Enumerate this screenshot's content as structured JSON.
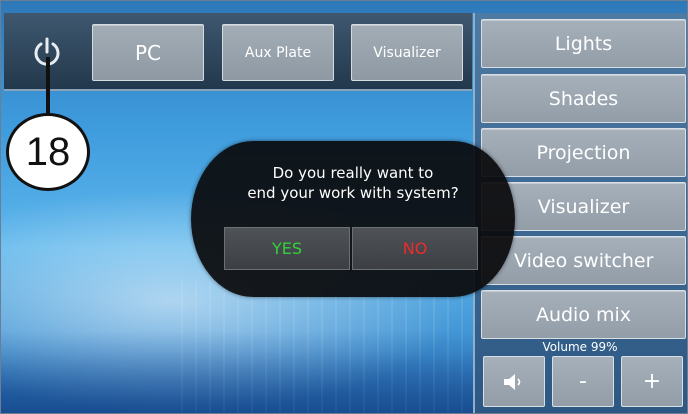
{
  "top_bar": {
    "power_icon": "power-icon",
    "buttons": [
      {
        "label": "PC"
      },
      {
        "label": "Aux Plate"
      },
      {
        "label": "Visualizer"
      }
    ]
  },
  "callout": {
    "number": "18"
  },
  "side_menu": {
    "items": [
      {
        "label": "Lights"
      },
      {
        "label": "Shades"
      },
      {
        "label": "Projection"
      },
      {
        "label": "Visualizer"
      },
      {
        "label": "Video switcher"
      },
      {
        "label": "Audio mix"
      }
    ]
  },
  "volume": {
    "label": "Volume  99%",
    "level_percent": 99,
    "mute_icon": "speaker-mute-icon",
    "minus_label": "-",
    "plus_label": "+"
  },
  "dialog": {
    "line1": "Do you really want to",
    "line2": "end your work with system?",
    "yes_label": "YES",
    "no_label": "NO",
    "yes_color": "#33d13a",
    "no_color": "#ef2a2a"
  }
}
